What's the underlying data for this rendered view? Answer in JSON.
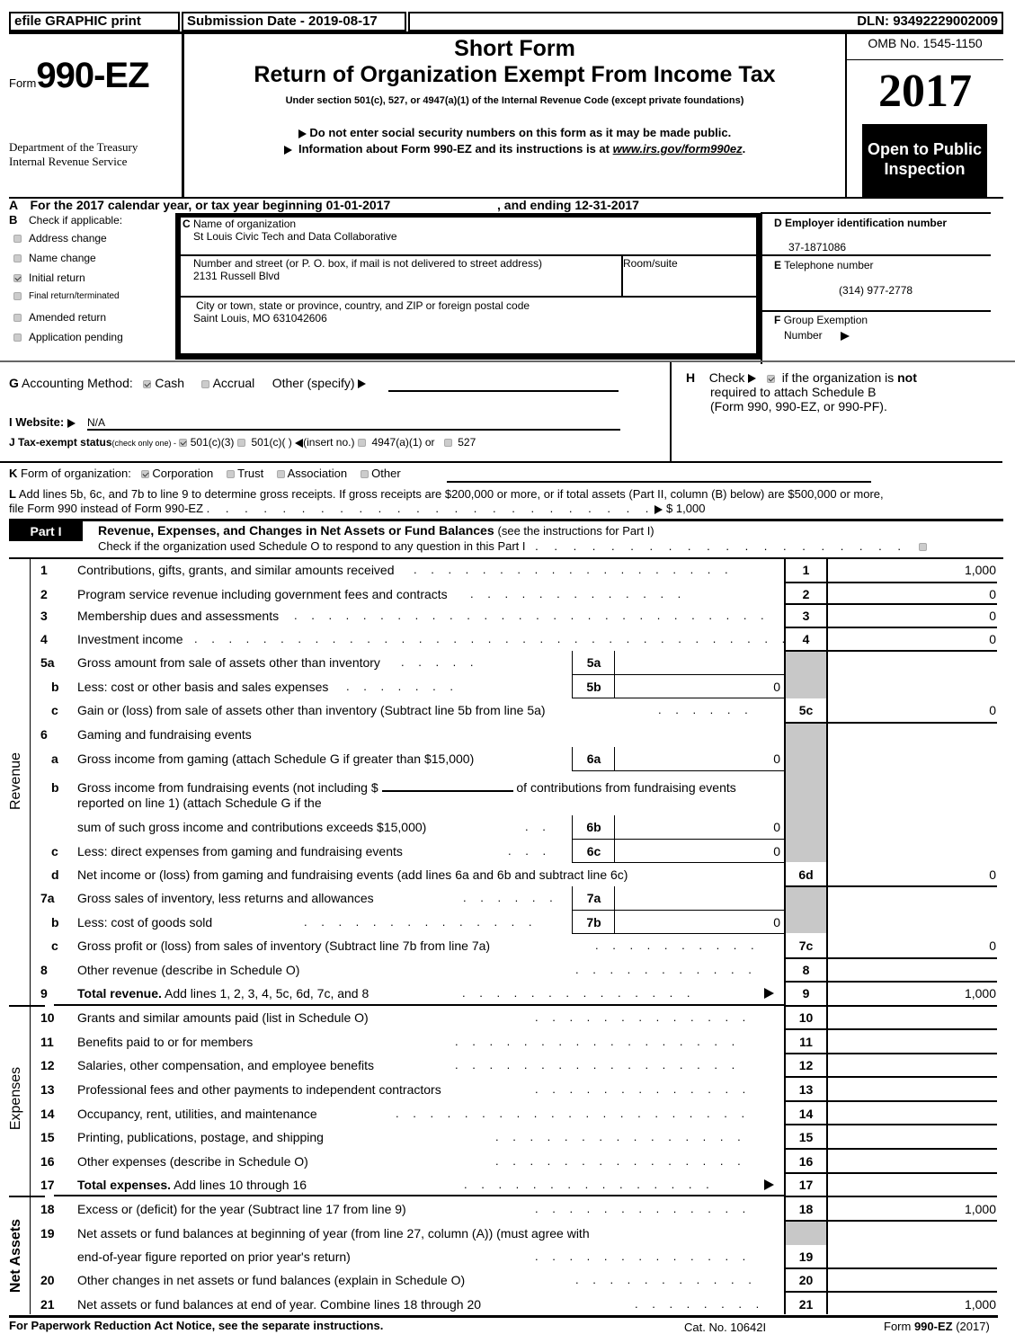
{
  "header": {
    "efile": "efile GRAPHIC print",
    "submission_date": "Submission Date - 2019-08-17",
    "dln": "DLN: 93492229002009",
    "form_prefix": "Form",
    "form_number": "990-EZ",
    "dept_line1": "Department of the Treasury",
    "dept_line2": "Internal Revenue Service",
    "title_short": "Short Form",
    "title_main": "Return of Organization Exempt From Income Tax",
    "subtitle": "Under section 501(c), 527, or 4947(a)(1) of the Internal Revenue Code (except private foundations)",
    "notice1": "Do not enter social security numbers on this form as it may be made public.",
    "notice2_prefix": "Information about Form 990-EZ and its instructions is at ",
    "notice2_link": "www.irs.gov/form990ez",
    "notice2_suffix": ".",
    "omb": "OMB No. 1545-1150",
    "year": "2017",
    "open_public_1": "Open to Public",
    "open_public_2": "Inspection"
  },
  "section_a": {
    "letter": "A",
    "text_prefix": "For the 2017 calendar year, or tax year beginning 01-01-2017",
    "text_suffix": ", and ending 12-31-2017"
  },
  "section_b": {
    "letter": "B",
    "title": "Check if applicable:",
    "items": [
      {
        "label": "Address change",
        "checked": false
      },
      {
        "label": "Name change",
        "checked": false
      },
      {
        "label": "Initial return",
        "checked": true
      },
      {
        "label": "Final return/terminated",
        "checked": false
      },
      {
        "label": "Amended return",
        "checked": false
      },
      {
        "label": "Application pending",
        "checked": false
      }
    ]
  },
  "section_c": {
    "letter": "C",
    "name_label": "Name of organization",
    "name_value": "St Louis Civic Tech and Data Collaborative",
    "street_label": "Number and street (or P. O. box, if mail is not delivered to street address)",
    "street_value": "2131 Russell Blvd",
    "room_label": "Room/suite",
    "room_value": "",
    "city_label": "City or town, state or province, country, and ZIP or foreign postal code",
    "city_value": "Saint Louis, MO   631042606"
  },
  "section_d": {
    "letter": "D",
    "label": "Employer identification number",
    "value": "37-1871086"
  },
  "section_e": {
    "letter": "E",
    "label": "Telephone number",
    "value": "(314) 977-2778"
  },
  "section_f": {
    "letter": "F",
    "label1": "Group Exemption",
    "label2": "Number",
    "value": ""
  },
  "section_g": {
    "letter": "G",
    "label": "Accounting Method:",
    "options": [
      {
        "label": "Cash",
        "checked": true
      },
      {
        "label": "Accrual",
        "checked": false
      }
    ],
    "other_label": "Other (specify)",
    "other_value": ""
  },
  "section_h": {
    "letter": "H",
    "check_label": "Check",
    "checked": true,
    "text1_prefix": "if the organization is ",
    "text1_bold": "not",
    "text2": "required to attach Schedule B",
    "text3": "(Form 990, 990-EZ, or 990-PF)."
  },
  "section_i": {
    "letter": "I",
    "label": "Website:",
    "value": "N/A"
  },
  "section_j": {
    "letter": "J",
    "label": "Tax-exempt status",
    "hint": "(check only one) -",
    "options": [
      {
        "label": "501(c)(3)",
        "checked": true
      },
      {
        "label": "501(c)(  )",
        "checked": false
      },
      {
        "label": "4947(a)(1) or",
        "checked": false
      },
      {
        "label": "527",
        "checked": false
      }
    ],
    "insert_no": "(insert no.)"
  },
  "section_k": {
    "letter": "K",
    "label": "Form of organization:",
    "options": [
      {
        "label": "Corporation",
        "checked": true
      },
      {
        "label": "Trust",
        "checked": false
      },
      {
        "label": "Association",
        "checked": false
      },
      {
        "label": "Other",
        "checked": false
      }
    ]
  },
  "section_l": {
    "letter": "L",
    "text1": "Add lines 5b, 6c, and 7b to line 9 to determine gross receipts. If gross receipts are $200,000 or more, or if total assets (Part II, column (B) below) are $500,000 or more,",
    "text2": "file Form 990 instead of Form 990-EZ",
    "amount": "$ 1,000"
  },
  "part1": {
    "badge": "Part I",
    "title": "Revenue, Expenses, and Changes in Net Assets or Fund Balances",
    "title_note": "(see the instructions for Part I)",
    "schedule_o": "Check if the organization used Schedule O to respond to any question in this Part I",
    "schedule_o_checked": false,
    "side_labels": {
      "revenue": "Revenue",
      "expenses": "Expenses",
      "net_assets": "Net Assets"
    }
  },
  "lines": {
    "l1": {
      "num": "1",
      "desc": "Contributions, gifts, grants, and similar amounts received",
      "box": "1",
      "value": "1,000"
    },
    "l2": {
      "num": "2",
      "desc": "Program service revenue including government fees and contracts",
      "box": "2",
      "value": "0"
    },
    "l3": {
      "num": "3",
      "desc": "Membership dues and assessments",
      "box": "3",
      "value": "0"
    },
    "l4": {
      "num": "4",
      "desc": "Investment income",
      "box": "4",
      "value": "0"
    },
    "l5a": {
      "num": "5a",
      "desc": "Gross amount from sale of assets other than inventory",
      "box": "5a",
      "value": ""
    },
    "l5b": {
      "num": "b",
      "desc": "Less: cost or other basis and sales expenses",
      "box": "5b",
      "value": "0"
    },
    "l5c": {
      "num": "c",
      "desc": "Gain or (loss) from sale of assets other than inventory (Subtract line 5b from line 5a)",
      "box": "5c",
      "value": "0"
    },
    "l6": {
      "num": "6",
      "desc": "Gaming and fundraising events"
    },
    "l6a": {
      "num": "a",
      "desc": "Gross income from gaming (attach Schedule G if greater than $15,000)",
      "box": "6a",
      "value": "0"
    },
    "l6b": {
      "num": "b",
      "desc1_prefix": "Gross income from fundraising events (not including $",
      "desc1_suffix": "of contributions from fundraising events",
      "desc2": "reported on line 1) (attach Schedule G if the",
      "desc3": "sum of such gross income and contributions exceeds $15,000)",
      "box": "6b",
      "value": "0",
      "blank_value": ""
    },
    "l6c": {
      "num": "c",
      "desc": "Less: direct expenses from gaming and fundraising events",
      "box": "6c",
      "value": "0"
    },
    "l6d": {
      "num": "d",
      "desc": "Net income or (loss) from gaming and fundraising events (add lines 6a and 6b and subtract line 6c)",
      "box": "6d",
      "value": "0"
    },
    "l7a": {
      "num": "7a",
      "desc": "Gross sales of inventory, less returns and allowances",
      "box": "7a",
      "value": ""
    },
    "l7b": {
      "num": "b",
      "desc": "Less: cost of goods sold",
      "box": "7b",
      "value": "0"
    },
    "l7c": {
      "num": "c",
      "desc": "Gross profit or (loss) from sales of inventory (Subtract line 7b from line 7a)",
      "box": "7c",
      "value": "0"
    },
    "l8": {
      "num": "8",
      "desc": "Other revenue (describe in Schedule O)",
      "box": "8",
      "value": ""
    },
    "l9": {
      "num": "9",
      "desc_bold": "Total revenue.",
      "desc": " Add lines 1, 2, 3, 4, 5c, 6d, 7c, and 8",
      "box": "9",
      "value": "1,000"
    },
    "l10": {
      "num": "10",
      "desc": "Grants and similar amounts paid (list in Schedule O)",
      "box": "10",
      "value": ""
    },
    "l11": {
      "num": "11",
      "desc": "Benefits paid to or for members",
      "box": "11",
      "value": ""
    },
    "l12": {
      "num": "12",
      "desc": "Salaries, other compensation, and employee benefits",
      "box": "12",
      "value": ""
    },
    "l13": {
      "num": "13",
      "desc": "Professional fees and other payments to independent contractors",
      "box": "13",
      "value": ""
    },
    "l14": {
      "num": "14",
      "desc": "Occupancy, rent, utilities, and maintenance",
      "box": "14",
      "value": ""
    },
    "l15": {
      "num": "15",
      "desc": "Printing, publications, postage, and shipping",
      "box": "15",
      "value": ""
    },
    "l16": {
      "num": "16",
      "desc": "Other expenses (describe in Schedule O)",
      "box": "16",
      "value": ""
    },
    "l17": {
      "num": "17",
      "desc_bold": "Total expenses.",
      "desc": " Add lines 10 through 16",
      "box": "17",
      "value": ""
    },
    "l18": {
      "num": "18",
      "desc": "Excess or (deficit) for the year (Subtract line 17 from line 9)",
      "box": "18",
      "value": "1,000"
    },
    "l19": {
      "num": "19",
      "desc1": "Net assets or fund balances at beginning of year (from line 27, column (A)) (must agree with",
      "desc2": "end-of-year figure reported on prior year's return)",
      "box": "19",
      "value": ""
    },
    "l20": {
      "num": "20",
      "desc": "Other changes in net assets or fund balances (explain in Schedule O)",
      "box": "20",
      "value": ""
    },
    "l21": {
      "num": "21",
      "desc": "Net assets or fund balances at end of year. Combine lines 18 through 20",
      "box": "21",
      "value": "1,000"
    }
  },
  "footer": {
    "paperwork": "For Paperwork Reduction Act Notice, see the separate instructions.",
    "cat_no": "Cat. No. 10642I",
    "form_prefix": "Form ",
    "form_bold": "990-EZ",
    "form_suffix": " (2017)"
  }
}
